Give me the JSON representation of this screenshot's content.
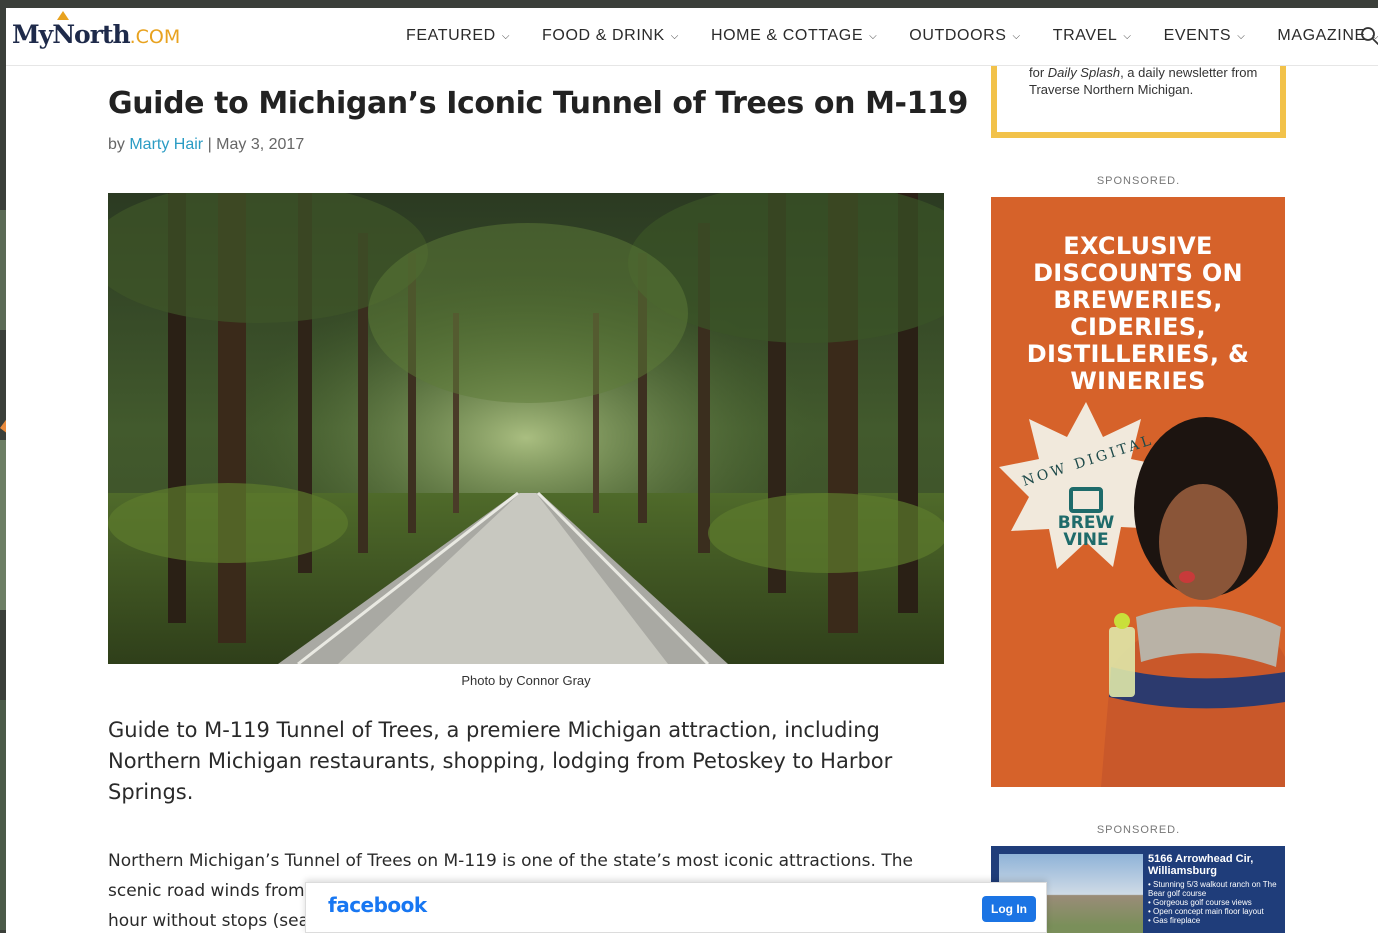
{
  "site": {
    "logo_main": "MyNorth",
    "logo_suffix": ".COM"
  },
  "nav": {
    "items": [
      {
        "label": "FEATURED"
      },
      {
        "label": "FOOD & DRINK"
      },
      {
        "label": "HOME & COTTAGE"
      },
      {
        "label": "OUTDOORS"
      },
      {
        "label": "TRAVEL"
      },
      {
        "label": "EVENTS"
      },
      {
        "label": "MAGAZINE"
      }
    ],
    "icons": {
      "dropdown": "chevron-down-icon",
      "search": "search-icon"
    }
  },
  "article": {
    "title": "Guide to Michigan’s Iconic Tunnel of Trees on M-119",
    "by_prefix": "by ",
    "author": "Marty Hair",
    "separator": " | ",
    "date": "May 3, 2017",
    "photo_caption": "Photo by Connor Gray",
    "lead": "Guide to M-119 Tunnel of Trees, a premiere Michigan attraction, including Northern Michigan restaurants, shopping, lodging from Petoskey to Harbor Springs.",
    "body_line1": "Northern Michigan’s Tunnel of Trees on M-119 is one of the state’s most iconic attractions. The",
    "body_line2": "scenic road winds from Harbor Springs, north of Petoskey, to Cross Village and takes about an",
    "body_line3": "hour without stops (sea"
  },
  "sidebar": {
    "newsletter_prefix": "for ",
    "newsletter_name": "Daily Splash",
    "newsletter_suffix": ", a daily newsletter from Traverse Northern Michigan.",
    "sponsored_label_1": "SPONSORED.",
    "sponsored_label_2": "SPONSORED.",
    "ad1": {
      "headline": "EXCLUSIVE DISCOUNTS ON BREWERIES, CIDERIES, DISTILLERIES, & WINERIES",
      "badge_arc": "NOW DIGITAL",
      "brand_line1": "BREW",
      "brand_line2": "VINE",
      "colors": {
        "background": "#d6622a",
        "badge": "#f1e9dc",
        "brand": "#1e6b6a"
      }
    },
    "ad2": {
      "address": "5166 Arrowhead Cir, Williamsburg",
      "bullets": [
        "• Stunning 5/3 walkout ranch on The Bear golf course",
        "• Gorgeous golf course views",
        "• Open concept main floor layout",
        "• Gas fireplace"
      ]
    }
  },
  "facebook_bar": {
    "logo": "facebook",
    "login_label": "Log In"
  }
}
